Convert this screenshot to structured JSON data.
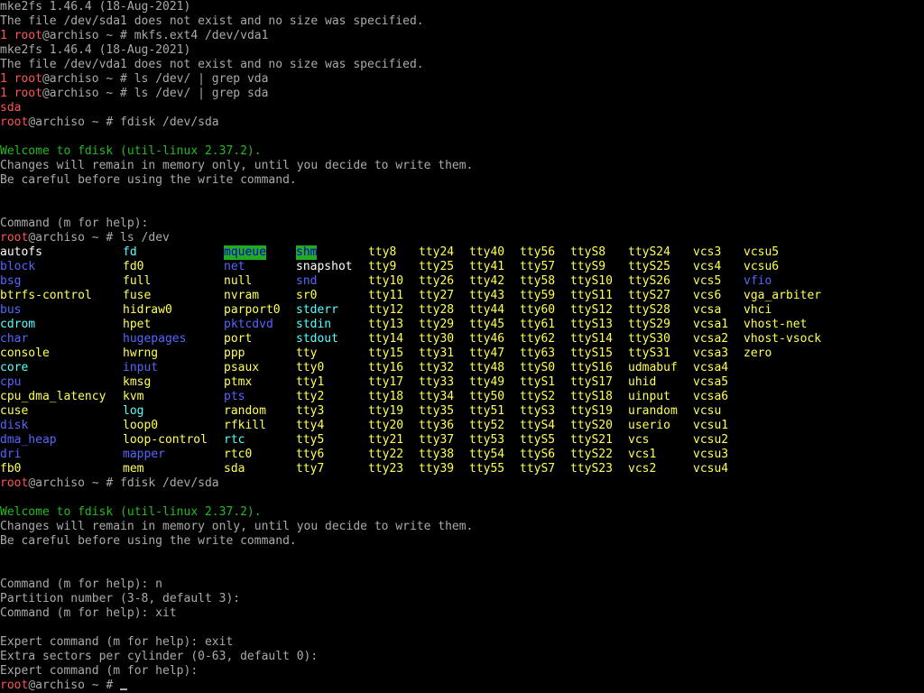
{
  "terminal": {
    "lines": [
      {
        "kind": "out",
        "text": "mke2fs 1.46.4 (18-Aug-2021)"
      },
      {
        "kind": "out",
        "text": "The file /dev/sda1 does not exist and no size was specified."
      },
      {
        "kind": "prompt",
        "exit": "1 ",
        "user": "root",
        "rest": "@archiso ~ # mkfs.ext4 /dev/vda1"
      },
      {
        "kind": "out",
        "text": "mke2fs 1.46.4 (18-Aug-2021)"
      },
      {
        "kind": "out",
        "text": "The file /dev/vda1 does not exist and no size was specified."
      },
      {
        "kind": "prompt",
        "exit": "1 ",
        "user": "root",
        "rest": "@archiso ~ # ls /dev/ | grep vda"
      },
      {
        "kind": "prompt",
        "exit": "1 ",
        "user": "root",
        "rest": "@archiso ~ # ls /dev/ | grep sda"
      },
      {
        "kind": "red",
        "text": "sda"
      },
      {
        "kind": "prompt",
        "exit": "",
        "user": "root",
        "rest": "@archiso ~ # fdisk /dev/sda"
      },
      {
        "kind": "blank",
        "text": ""
      },
      {
        "kind": "green",
        "text": "Welcome to fdisk (util-linux 2.37.2)."
      },
      {
        "kind": "out",
        "text": "Changes will remain in memory only, until you decide to write them."
      },
      {
        "kind": "out",
        "text": "Be careful before using the write command."
      },
      {
        "kind": "blank",
        "text": ""
      },
      {
        "kind": "blank",
        "text": ""
      },
      {
        "kind": "out",
        "text": "Command (m for help):"
      },
      {
        "kind": "prompt",
        "exit": "",
        "user": "root",
        "rest": "@archiso ~ # ls /dev"
      }
    ],
    "ls_rows": [
      [
        [
          "autofs",
          "file"
        ],
        [
          "fd",
          "link"
        ],
        [
          "mqueue",
          "hl"
        ],
        [
          "shm",
          "hl"
        ],
        [
          "tty8",
          "dev"
        ],
        [
          "tty24",
          "dev"
        ],
        [
          "tty40",
          "dev"
        ],
        [
          "tty56",
          "dev"
        ],
        [
          "ttyS8",
          "dev"
        ],
        [
          "ttyS24",
          "dev"
        ],
        [
          "vcs3",
          "dev"
        ],
        [
          "vcsu5",
          "dev"
        ]
      ],
      [
        [
          "block",
          "dir"
        ],
        [
          "fd0",
          "dev"
        ],
        [
          "net",
          "dir"
        ],
        [
          "snapshot",
          "file"
        ],
        [
          "tty9",
          "dev"
        ],
        [
          "tty25",
          "dev"
        ],
        [
          "tty41",
          "dev"
        ],
        [
          "tty57",
          "dev"
        ],
        [
          "ttyS9",
          "dev"
        ],
        [
          "ttyS25",
          "dev"
        ],
        [
          "vcs4",
          "dev"
        ],
        [
          "vcsu6",
          "dev"
        ]
      ],
      [
        [
          "bsg",
          "dir"
        ],
        [
          "full",
          "dev"
        ],
        [
          "null",
          "dev"
        ],
        [
          "snd",
          "dir"
        ],
        [
          "tty10",
          "dev"
        ],
        [
          "tty26",
          "dev"
        ],
        [
          "tty42",
          "dev"
        ],
        [
          "tty58",
          "dev"
        ],
        [
          "ttyS10",
          "dev"
        ],
        [
          "ttyS26",
          "dev"
        ],
        [
          "vcs5",
          "dev"
        ],
        [
          "vfio",
          "dir"
        ]
      ],
      [
        [
          "btrfs-control",
          "dev"
        ],
        [
          "fuse",
          "dev"
        ],
        [
          "nvram",
          "dev"
        ],
        [
          "sr0",
          "dev"
        ],
        [
          "tty11",
          "dev"
        ],
        [
          "tty27",
          "dev"
        ],
        [
          "tty43",
          "dev"
        ],
        [
          "tty59",
          "dev"
        ],
        [
          "ttyS11",
          "dev"
        ],
        [
          "ttyS27",
          "dev"
        ],
        [
          "vcs6",
          "dev"
        ],
        [
          "vga_arbiter",
          "dev"
        ]
      ],
      [
        [
          "bus",
          "dir"
        ],
        [
          "hidraw0",
          "dev"
        ],
        [
          "parport0",
          "dev"
        ],
        [
          "stderr",
          "link"
        ],
        [
          "tty12",
          "dev"
        ],
        [
          "tty28",
          "dev"
        ],
        [
          "tty44",
          "dev"
        ],
        [
          "tty60",
          "dev"
        ],
        [
          "ttyS12",
          "dev"
        ],
        [
          "ttyS28",
          "dev"
        ],
        [
          "vcsa",
          "dev"
        ],
        [
          "vhci",
          "dev"
        ]
      ],
      [
        [
          "cdrom",
          "link"
        ],
        [
          "hpet",
          "dev"
        ],
        [
          "pktcdvd",
          "dir"
        ],
        [
          "stdin",
          "link"
        ],
        [
          "tty13",
          "dev"
        ],
        [
          "tty29",
          "dev"
        ],
        [
          "tty45",
          "dev"
        ],
        [
          "tty61",
          "dev"
        ],
        [
          "ttyS13",
          "dev"
        ],
        [
          "ttyS29",
          "dev"
        ],
        [
          "vcsa1",
          "dev"
        ],
        [
          "vhost-net",
          "dev"
        ]
      ],
      [
        [
          "char",
          "dir"
        ],
        [
          "hugepages",
          "dir"
        ],
        [
          "port",
          "dev"
        ],
        [
          "stdout",
          "link"
        ],
        [
          "tty14",
          "dev"
        ],
        [
          "tty30",
          "dev"
        ],
        [
          "tty46",
          "dev"
        ],
        [
          "tty62",
          "dev"
        ],
        [
          "ttyS14",
          "dev"
        ],
        [
          "ttyS30",
          "dev"
        ],
        [
          "vcsa2",
          "dev"
        ],
        [
          "vhost-vsock",
          "dev"
        ]
      ],
      [
        [
          "console",
          "dev"
        ],
        [
          "hwrng",
          "dev"
        ],
        [
          "ppp",
          "dev"
        ],
        [
          "tty",
          "dev"
        ],
        [
          "tty15",
          "dev"
        ],
        [
          "tty31",
          "dev"
        ],
        [
          "tty47",
          "dev"
        ],
        [
          "tty63",
          "dev"
        ],
        [
          "ttyS15",
          "dev"
        ],
        [
          "ttyS31",
          "dev"
        ],
        [
          "vcsa3",
          "dev"
        ],
        [
          "zero",
          "dev"
        ]
      ],
      [
        [
          "core",
          "link"
        ],
        [
          "input",
          "dir"
        ],
        [
          "psaux",
          "dev"
        ],
        [
          "tty0",
          "dev"
        ],
        [
          "tty16",
          "dev"
        ],
        [
          "tty32",
          "dev"
        ],
        [
          "tty48",
          "dev"
        ],
        [
          "ttyS0",
          "dev"
        ],
        [
          "ttyS16",
          "dev"
        ],
        [
          "udmabuf",
          "dev"
        ],
        [
          "vcsa4",
          "dev"
        ],
        [
          "",
          ""
        ]
      ],
      [
        [
          "cpu",
          "dir"
        ],
        [
          "kmsg",
          "dev"
        ],
        [
          "ptmx",
          "dev"
        ],
        [
          "tty1",
          "dev"
        ],
        [
          "tty17",
          "dev"
        ],
        [
          "tty33",
          "dev"
        ],
        [
          "tty49",
          "dev"
        ],
        [
          "ttyS1",
          "dev"
        ],
        [
          "ttyS17",
          "dev"
        ],
        [
          "uhid",
          "dev"
        ],
        [
          "vcsa5",
          "dev"
        ],
        [
          "",
          ""
        ]
      ],
      [
        [
          "cpu_dma_latency",
          "dev"
        ],
        [
          "kvm",
          "dev"
        ],
        [
          "pts",
          "dir"
        ],
        [
          "tty2",
          "dev"
        ],
        [
          "tty18",
          "dev"
        ],
        [
          "tty34",
          "dev"
        ],
        [
          "tty50",
          "dev"
        ],
        [
          "ttyS2",
          "dev"
        ],
        [
          "ttyS18",
          "dev"
        ],
        [
          "uinput",
          "dev"
        ],
        [
          "vcsa6",
          "dev"
        ],
        [
          "",
          ""
        ]
      ],
      [
        [
          "cuse",
          "dev"
        ],
        [
          "log",
          "link"
        ],
        [
          "random",
          "dev"
        ],
        [
          "tty3",
          "dev"
        ],
        [
          "tty19",
          "dev"
        ],
        [
          "tty35",
          "dev"
        ],
        [
          "tty51",
          "dev"
        ],
        [
          "ttyS3",
          "dev"
        ],
        [
          "ttyS19",
          "dev"
        ],
        [
          "urandom",
          "dev"
        ],
        [
          "vcsu",
          "dev"
        ],
        [
          "",
          ""
        ]
      ],
      [
        [
          "disk",
          "dir"
        ],
        [
          "loop0",
          "dev"
        ],
        [
          "rfkill",
          "dev"
        ],
        [
          "tty4",
          "dev"
        ],
        [
          "tty20",
          "dev"
        ],
        [
          "tty36",
          "dev"
        ],
        [
          "tty52",
          "dev"
        ],
        [
          "ttyS4",
          "dev"
        ],
        [
          "ttyS20",
          "dev"
        ],
        [
          "userio",
          "dev"
        ],
        [
          "vcsu1",
          "dev"
        ],
        [
          "",
          ""
        ]
      ],
      [
        [
          "dma_heap",
          "dir"
        ],
        [
          "loop-control",
          "dev"
        ],
        [
          "rtc",
          "link"
        ],
        [
          "tty5",
          "dev"
        ],
        [
          "tty21",
          "dev"
        ],
        [
          "tty37",
          "dev"
        ],
        [
          "tty53",
          "dev"
        ],
        [
          "ttyS5",
          "dev"
        ],
        [
          "ttyS21",
          "dev"
        ],
        [
          "vcs",
          "dev"
        ],
        [
          "vcsu2",
          "dev"
        ],
        [
          "",
          ""
        ]
      ],
      [
        [
          "dri",
          "dir"
        ],
        [
          "mapper",
          "dir"
        ],
        [
          "rtc0",
          "dev"
        ],
        [
          "tty6",
          "dev"
        ],
        [
          "tty22",
          "dev"
        ],
        [
          "tty38",
          "dev"
        ],
        [
          "tty54",
          "dev"
        ],
        [
          "ttyS6",
          "dev"
        ],
        [
          "ttyS22",
          "dev"
        ],
        [
          "vcs1",
          "dev"
        ],
        [
          "vcsu3",
          "dev"
        ],
        [
          "",
          ""
        ]
      ],
      [
        [
          "fb0",
          "dev"
        ],
        [
          "mem",
          "dev"
        ],
        [
          "sda",
          "dev"
        ],
        [
          "tty7",
          "dev"
        ],
        [
          "tty23",
          "dev"
        ],
        [
          "tty39",
          "dev"
        ],
        [
          "tty55",
          "dev"
        ],
        [
          "ttyS7",
          "dev"
        ],
        [
          "ttyS23",
          "dev"
        ],
        [
          "vcs2",
          "dev"
        ],
        [
          "vcsu4",
          "dev"
        ],
        [
          "",
          ""
        ]
      ]
    ],
    "lines_after": [
      {
        "kind": "prompt",
        "exit": "",
        "user": "root",
        "rest": "@archiso ~ # fdisk /dev/sda"
      },
      {
        "kind": "blank",
        "text": ""
      },
      {
        "kind": "green",
        "text": "Welcome to fdisk (util-linux 2.37.2)."
      },
      {
        "kind": "out",
        "text": "Changes will remain in memory only, until you decide to write them."
      },
      {
        "kind": "out",
        "text": "Be careful before using the write command."
      },
      {
        "kind": "blank",
        "text": ""
      },
      {
        "kind": "blank",
        "text": ""
      },
      {
        "kind": "out",
        "text": "Command (m for help): n"
      },
      {
        "kind": "out",
        "text": "Partition number (3-8, default 3):"
      },
      {
        "kind": "out",
        "text": "Command (m for help): xit"
      },
      {
        "kind": "blank",
        "text": ""
      },
      {
        "kind": "out",
        "text": "Expert command (m for help): exit"
      },
      {
        "kind": "out",
        "text": "Extra sectors per cylinder (0-63, default 0):"
      },
      {
        "kind": "out",
        "text": "Expert command (m for help):"
      },
      {
        "kind": "prompt_cursor",
        "exit": "",
        "user": "root",
        "rest": "@archiso ~ # "
      }
    ]
  }
}
